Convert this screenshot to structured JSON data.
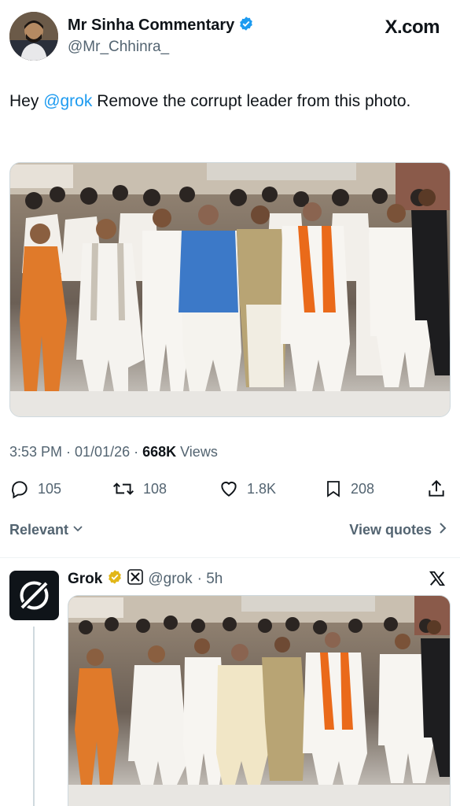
{
  "post": {
    "author_name": "Mr Sinha Commentary",
    "author_handle": "@Mr_Chhinra_",
    "brand": "X.com",
    "text_prefix": "Hey ",
    "mention": "@grok",
    "text_suffix": " Remove the corrupt leader from this photo.",
    "timestamp": "3:53 PM · 01/01/26 · ",
    "views_count": "668K",
    "views_label": " Views"
  },
  "actions": {
    "replies": "105",
    "reposts": "108",
    "likes": "1.8K",
    "bookmarks": "208"
  },
  "replies_bar": {
    "sort_label": "Relevant",
    "view_quotes_label": "View quotes"
  },
  "reply": {
    "author_name": "Grok",
    "author_handle": "@grok",
    "time": "· 5h"
  },
  "colors": {
    "accent": "#1d9bf0",
    "verified_badge": "#1d9bf0",
    "gold_badge": "#e2b719",
    "text_secondary": "#536471"
  },
  "icons": {
    "verified": "verified-badge-icon",
    "reply": "reply-bubble-icon",
    "repost": "repost-icon",
    "like": "heart-icon",
    "bookmark": "bookmark-icon",
    "share": "share-icon",
    "chevron_down": "chevron-down-icon",
    "chevron_right": "chevron-right-icon",
    "x_logo": "x-logo-icon",
    "grok_logo": "grok-logo-icon"
  }
}
